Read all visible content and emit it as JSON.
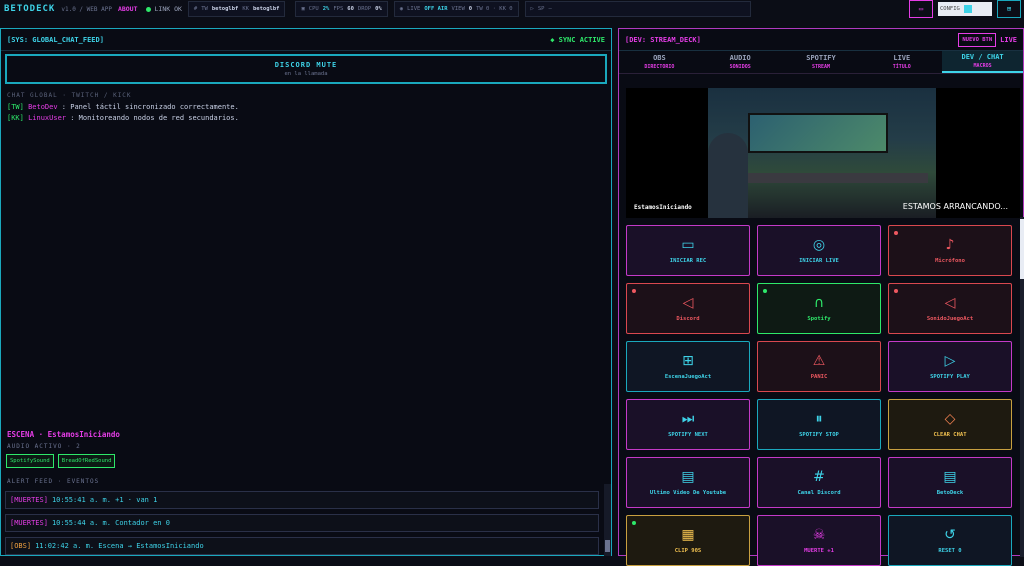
{
  "app": {
    "logo": "BETODECK",
    "version": "v1.0 / WEB APP",
    "about": "ABOUT",
    "link": "LINK OK"
  },
  "top": {
    "tw": "TW",
    "tw_user": "betoglbf",
    "kk": "KK",
    "kk_user": "betoglbf",
    "cpu_l": "CPU",
    "cpu": "2%",
    "fps_l": "FPS",
    "fps": "60",
    "drop_l": "DROP",
    "drop": "0%",
    "live_l": "LIVE",
    "live": "OFF AIR",
    "view_l": "VIEW",
    "view": "0",
    "counts": "TW 0 · KK 0",
    "sp_l": "SP",
    "sp": "—",
    "config": "CONFIG"
  },
  "left": {
    "header": "[SYS: GLOBAL_CHAT_FEED]",
    "sync": "◆ SYNC ACTIVE",
    "mute_title": "DISCORD MUTE",
    "mute_sub": "en la llamada",
    "chat_title": "CHAT GLOBAL · TWITCH / KICK",
    "messages": [
      {
        "tag": "[TW]",
        "user": "BetoDev",
        "text": "Panel táctil sincronizado correctamente."
      },
      {
        "tag": "[KK]",
        "user": "LinuxUser",
        "text": "Monitoreando nodos de red secundarios."
      }
    ],
    "scene": "ESCENA · EstamosIniciando",
    "audio": "AUDIO ACTIVO · 2",
    "chips": [
      "SpotifySound",
      "BreadOfRedSound"
    ],
    "alert_title": "ALERT FEED · EVENTOS",
    "alerts": [
      {
        "tag": "[MUERTES]",
        "text": "10:55:41 a. m. +1 · van 1"
      },
      {
        "tag": "[MUERTES]",
        "text": "10:55:44 a. m. Contador en 0"
      },
      {
        "tag": "[OBS]",
        "text": "11:02:42 a. m. Escena → EstamosIniciando"
      }
    ]
  },
  "right": {
    "header": "[DEV: STREAM_DECK]",
    "new_btn": "NUEVO BTN",
    "live": "LIVE",
    "tabs": [
      {
        "label": "OBS",
        "sub": "DIRECTORIO"
      },
      {
        "label": "AUDIO",
        "sub": "SONIDOS"
      },
      {
        "label": "SPOTIFY",
        "sub": "STREAM"
      },
      {
        "label": "LIVE",
        "sub": "TÍTULO"
      },
      {
        "label": "DEV / CHAT",
        "sub": "MACROS"
      }
    ],
    "video_caption": "ESTAMOS ARRANCANDO...",
    "video_label": "EstamosIniciando",
    "buttons": [
      {
        "label": "INICIAR REC",
        "icon": "video-camera-icon",
        "glyph": "▭"
      },
      {
        "label": "INICIAR LIVE",
        "icon": "broadcast-icon",
        "glyph": "◎"
      },
      {
        "label": "Micrófono",
        "icon": "microphone-icon",
        "glyph": "♪"
      },
      {
        "label": "Discord",
        "icon": "speaker-icon",
        "glyph": "◁"
      },
      {
        "label": "Spotify",
        "icon": "headphones-icon",
        "glyph": "∩"
      },
      {
        "label": "SonidoJuegoAct",
        "icon": "speaker-icon",
        "glyph": "◁"
      },
      {
        "label": "EscenaJuegoAct",
        "icon": "gamepad-icon",
        "glyph": "⊞"
      },
      {
        "label": "PANIC",
        "icon": "siren-icon",
        "glyph": "⚠"
      },
      {
        "label": "SPOTIFY PLAY",
        "icon": "play-icon",
        "glyph": "▷"
      },
      {
        "label": "SPOTIFY NEXT",
        "icon": "skip-next-icon",
        "glyph": "⏭"
      },
      {
        "label": "SPOTIFY STOP",
        "icon": "pause-icon",
        "glyph": "⏸"
      },
      {
        "label": "CLEAR CHAT",
        "icon": "eraser-icon",
        "glyph": "◇"
      },
      {
        "label": "Ultimo Video De Youtube",
        "icon": "clapperboard-icon",
        "glyph": "▤"
      },
      {
        "label": "Canal Discord",
        "icon": "hash-icon",
        "glyph": "#"
      },
      {
        "label": "BetoDeck",
        "icon": "clapperboard-icon",
        "glyph": "▤"
      },
      {
        "label": "CLIP 90S",
        "icon": "film-icon",
        "glyph": "▦"
      },
      {
        "label": "MUERTE +1",
        "icon": "skull-icon",
        "glyph": "☠"
      },
      {
        "label": "RESET 0",
        "icon": "reset-icon",
        "glyph": "↺"
      }
    ]
  }
}
